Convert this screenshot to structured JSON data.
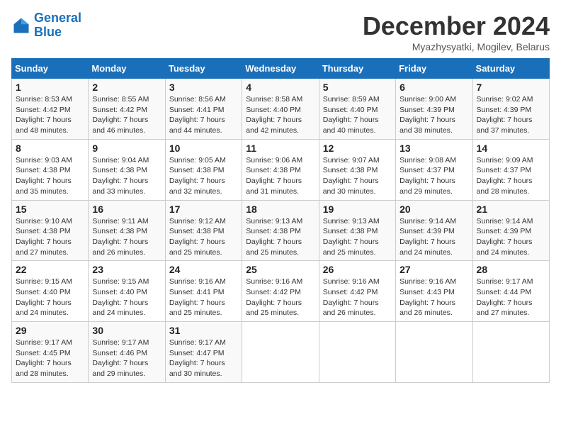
{
  "header": {
    "logo_line1": "General",
    "logo_line2": "Blue",
    "month": "December 2024",
    "location": "Myazhysyatki, Mogilev, Belarus"
  },
  "days_of_week": [
    "Sunday",
    "Monday",
    "Tuesday",
    "Wednesday",
    "Thursday",
    "Friday",
    "Saturday"
  ],
  "weeks": [
    [
      {
        "day": "1",
        "rise": "Sunrise: 8:53 AM",
        "set": "Sunset: 4:42 PM",
        "daylight": "Daylight: 7 hours and 48 minutes."
      },
      {
        "day": "2",
        "rise": "Sunrise: 8:55 AM",
        "set": "Sunset: 4:42 PM",
        "daylight": "Daylight: 7 hours and 46 minutes."
      },
      {
        "day": "3",
        "rise": "Sunrise: 8:56 AM",
        "set": "Sunset: 4:41 PM",
        "daylight": "Daylight: 7 hours and 44 minutes."
      },
      {
        "day": "4",
        "rise": "Sunrise: 8:58 AM",
        "set": "Sunset: 4:40 PM",
        "daylight": "Daylight: 7 hours and 42 minutes."
      },
      {
        "day": "5",
        "rise": "Sunrise: 8:59 AM",
        "set": "Sunset: 4:40 PM",
        "daylight": "Daylight: 7 hours and 40 minutes."
      },
      {
        "day": "6",
        "rise": "Sunrise: 9:00 AM",
        "set": "Sunset: 4:39 PM",
        "daylight": "Daylight: 7 hours and 38 minutes."
      },
      {
        "day": "7",
        "rise": "Sunrise: 9:02 AM",
        "set": "Sunset: 4:39 PM",
        "daylight": "Daylight: 7 hours and 37 minutes."
      }
    ],
    [
      {
        "day": "8",
        "rise": "Sunrise: 9:03 AM",
        "set": "Sunset: 4:38 PM",
        "daylight": "Daylight: 7 hours and 35 minutes."
      },
      {
        "day": "9",
        "rise": "Sunrise: 9:04 AM",
        "set": "Sunset: 4:38 PM",
        "daylight": "Daylight: 7 hours and 33 minutes."
      },
      {
        "day": "10",
        "rise": "Sunrise: 9:05 AM",
        "set": "Sunset: 4:38 PM",
        "daylight": "Daylight: 7 hours and 32 minutes."
      },
      {
        "day": "11",
        "rise": "Sunrise: 9:06 AM",
        "set": "Sunset: 4:38 PM",
        "daylight": "Daylight: 7 hours and 31 minutes."
      },
      {
        "day": "12",
        "rise": "Sunrise: 9:07 AM",
        "set": "Sunset: 4:38 PM",
        "daylight": "Daylight: 7 hours and 30 minutes."
      },
      {
        "day": "13",
        "rise": "Sunrise: 9:08 AM",
        "set": "Sunset: 4:37 PM",
        "daylight": "Daylight: 7 hours and 29 minutes."
      },
      {
        "day": "14",
        "rise": "Sunrise: 9:09 AM",
        "set": "Sunset: 4:37 PM",
        "daylight": "Daylight: 7 hours and 28 minutes."
      }
    ],
    [
      {
        "day": "15",
        "rise": "Sunrise: 9:10 AM",
        "set": "Sunset: 4:38 PM",
        "daylight": "Daylight: 7 hours and 27 minutes."
      },
      {
        "day": "16",
        "rise": "Sunrise: 9:11 AM",
        "set": "Sunset: 4:38 PM",
        "daylight": "Daylight: 7 hours and 26 minutes."
      },
      {
        "day": "17",
        "rise": "Sunrise: 9:12 AM",
        "set": "Sunset: 4:38 PM",
        "daylight": "Daylight: 7 hours and 25 minutes."
      },
      {
        "day": "18",
        "rise": "Sunrise: 9:13 AM",
        "set": "Sunset: 4:38 PM",
        "daylight": "Daylight: 7 hours and 25 minutes."
      },
      {
        "day": "19",
        "rise": "Sunrise: 9:13 AM",
        "set": "Sunset: 4:38 PM",
        "daylight": "Daylight: 7 hours and 25 minutes."
      },
      {
        "day": "20",
        "rise": "Sunrise: 9:14 AM",
        "set": "Sunset: 4:39 PM",
        "daylight": "Daylight: 7 hours and 24 minutes."
      },
      {
        "day": "21",
        "rise": "Sunrise: 9:14 AM",
        "set": "Sunset: 4:39 PM",
        "daylight": "Daylight: 7 hours and 24 minutes."
      }
    ],
    [
      {
        "day": "22",
        "rise": "Sunrise: 9:15 AM",
        "set": "Sunset: 4:40 PM",
        "daylight": "Daylight: 7 hours and 24 minutes."
      },
      {
        "day": "23",
        "rise": "Sunrise: 9:15 AM",
        "set": "Sunset: 4:40 PM",
        "daylight": "Daylight: 7 hours and 24 minutes."
      },
      {
        "day": "24",
        "rise": "Sunrise: 9:16 AM",
        "set": "Sunset: 4:41 PM",
        "daylight": "Daylight: 7 hours and 25 minutes."
      },
      {
        "day": "25",
        "rise": "Sunrise: 9:16 AM",
        "set": "Sunset: 4:42 PM",
        "daylight": "Daylight: 7 hours and 25 minutes."
      },
      {
        "day": "26",
        "rise": "Sunrise: 9:16 AM",
        "set": "Sunset: 4:42 PM",
        "daylight": "Daylight: 7 hours and 26 minutes."
      },
      {
        "day": "27",
        "rise": "Sunrise: 9:16 AM",
        "set": "Sunset: 4:43 PM",
        "daylight": "Daylight: 7 hours and 26 minutes."
      },
      {
        "day": "28",
        "rise": "Sunrise: 9:17 AM",
        "set": "Sunset: 4:44 PM",
        "daylight": "Daylight: 7 hours and 27 minutes."
      }
    ],
    [
      {
        "day": "29",
        "rise": "Sunrise: 9:17 AM",
        "set": "Sunset: 4:45 PM",
        "daylight": "Daylight: 7 hours and 28 minutes."
      },
      {
        "day": "30",
        "rise": "Sunrise: 9:17 AM",
        "set": "Sunset: 4:46 PM",
        "daylight": "Daylight: 7 hours and 29 minutes."
      },
      {
        "day": "31",
        "rise": "Sunrise: 9:17 AM",
        "set": "Sunset: 4:47 PM",
        "daylight": "Daylight: 7 hours and 30 minutes."
      },
      null,
      null,
      null,
      null
    ]
  ]
}
